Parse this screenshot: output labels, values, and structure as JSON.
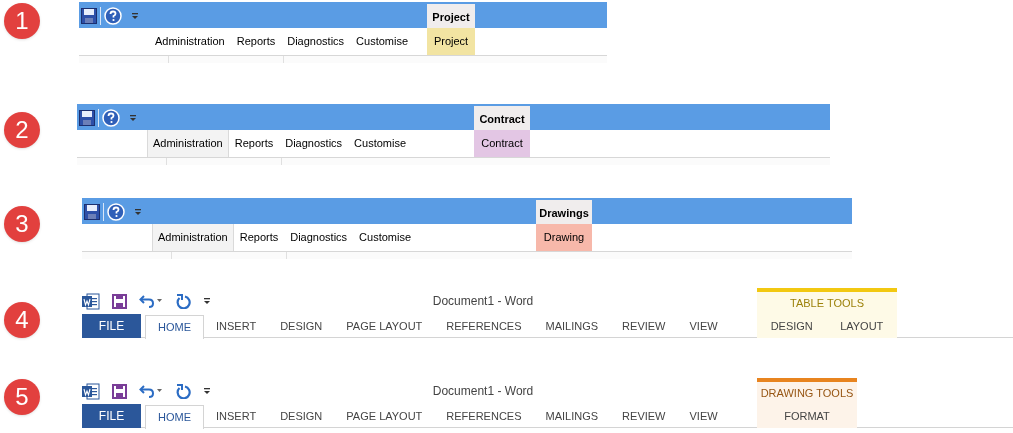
{
  "ribbons": [
    {
      "number": "1",
      "kind": "classic",
      "context_header": "Project",
      "tabs": [
        {
          "label": "Administration",
          "selected": false
        },
        {
          "label": "Reports",
          "selected": false
        },
        {
          "label": "Diagnostics",
          "selected": false
        },
        {
          "label": "Customise",
          "selected": false
        }
      ],
      "context_tab": {
        "label": "Project",
        "color": "#f2e4a2"
      }
    },
    {
      "number": "2",
      "kind": "classic",
      "context_header": "Contract",
      "tabs": [
        {
          "label": "Administration",
          "selected": true
        },
        {
          "label": "Reports",
          "selected": false
        },
        {
          "label": "Diagnostics",
          "selected": false
        },
        {
          "label": "Customise",
          "selected": false
        }
      ],
      "context_tab": {
        "label": "Contract",
        "color": "#e3c6e4"
      }
    },
    {
      "number": "3",
      "kind": "classic",
      "context_header": "Drawings",
      "tabs": [
        {
          "label": "Administration",
          "selected": true
        },
        {
          "label": "Reports",
          "selected": false
        },
        {
          "label": "Diagnostics",
          "selected": false
        },
        {
          "label": "Customise",
          "selected": false
        }
      ],
      "context_tab": {
        "label": "Drawing",
        "color": "#f7b8aa"
      }
    },
    {
      "number": "4",
      "kind": "word",
      "title": "Document1 - Word",
      "file_tab": "FILE",
      "tabs": [
        {
          "label": "HOME",
          "selected": true
        },
        {
          "label": "INSERT",
          "selected": false
        },
        {
          "label": "DESIGN",
          "selected": false
        },
        {
          "label": "PAGE LAYOUT",
          "selected": false
        },
        {
          "label": "REFERENCES",
          "selected": false
        },
        {
          "label": "MAILINGS",
          "selected": false
        },
        {
          "label": "REVIEW",
          "selected": false
        },
        {
          "label": "VIEW",
          "selected": false
        }
      ],
      "context_group": {
        "label": "TABLE TOOLS",
        "color": "#f2c811",
        "tabs": [
          "DESIGN",
          "LAYOUT"
        ]
      }
    },
    {
      "number": "5",
      "kind": "word",
      "title": "Document1 - Word",
      "file_tab": "FILE",
      "tabs": [
        {
          "label": "HOME",
          "selected": true
        },
        {
          "label": "INSERT",
          "selected": false
        },
        {
          "label": "DESIGN",
          "selected": false
        },
        {
          "label": "PAGE LAYOUT",
          "selected": false
        },
        {
          "label": "REFERENCES",
          "selected": false
        },
        {
          "label": "MAILINGS",
          "selected": false
        },
        {
          "label": "REVIEW",
          "selected": false
        },
        {
          "label": "VIEW",
          "selected": false
        }
      ],
      "context_group": {
        "label": "DRAWING TOOLS",
        "color": "#e8841f",
        "tabs": [
          "FORMAT"
        ]
      }
    }
  ]
}
